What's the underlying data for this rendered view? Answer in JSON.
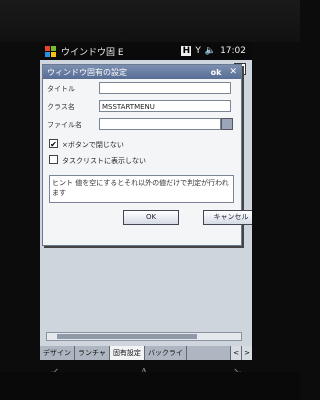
{
  "statusbar": {
    "title": "ウインドウ固 E",
    "h_badge": "H",
    "signal": "Y",
    "volume_icon": "speaker-icon",
    "time": "17:02"
  },
  "dialog": {
    "title": "ウィンドウ固有の設定",
    "ok_label": "ok",
    "close_label": "✕",
    "fields": {
      "title_label": "タイトル",
      "title_value": "",
      "class_label": "クラス名",
      "class_value": "MSSTARTMENU",
      "file_label": "ファイル名",
      "file_value": ""
    },
    "checkboxes": [
      {
        "label": "×ボタンで閉じない",
        "checked": true
      },
      {
        "label": "タスクリストに表示しない",
        "checked": false
      }
    ],
    "hint": "ヒント 値を空にするとそれ以外の値だけで判定が行われます",
    "ok_button": "OK",
    "cancel_button": "キャンセル"
  },
  "tabs": [
    {
      "label": "デザイン",
      "active": false
    },
    {
      "label": "ランチャ",
      "active": false
    },
    {
      "label": "固有設定",
      "active": true
    },
    {
      "label": "バックライ",
      "active": false
    }
  ],
  "tab_arrows": {
    "left": "<",
    "right": ">"
  },
  "softbar": {
    "left": "↙",
    "center": "A",
    "right": "↘"
  }
}
